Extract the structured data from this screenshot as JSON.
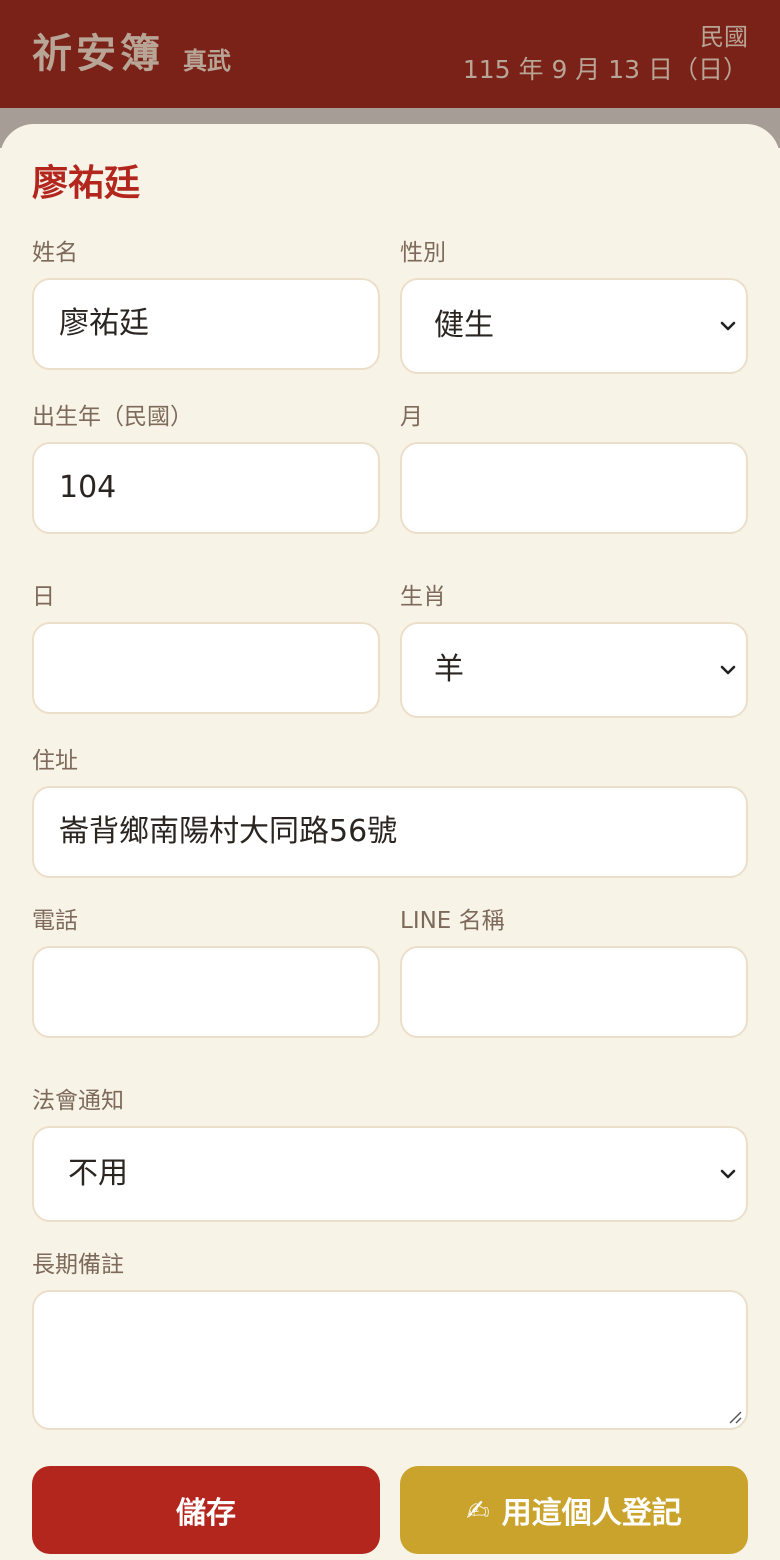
{
  "header": {
    "app_title": "祈安簿",
    "temple": "真武",
    "date_era": "民國",
    "date_full": "115 年 9 月 13 日（日）"
  },
  "form": {
    "title": "廖祐廷",
    "name": {
      "label": "姓名",
      "value": "廖祐廷"
    },
    "gender": {
      "label": "性別",
      "value": "健生"
    },
    "birth_year": {
      "label": "出生年（民國）",
      "value": "104"
    },
    "birth_month": {
      "label": "月",
      "value": ""
    },
    "birth_day": {
      "label": "日",
      "value": ""
    },
    "zodiac": {
      "label": "生肖",
      "value": "羊"
    },
    "address": {
      "label": "住址",
      "value": "崙背鄉南陽村大同路56號"
    },
    "phone": {
      "label": "電話",
      "value": ""
    },
    "line_name": {
      "label": "LINE 名稱",
      "value": ""
    },
    "notify": {
      "label": "法會通知",
      "value": "不用"
    },
    "notes": {
      "label": "長期備註",
      "value": ""
    }
  },
  "buttons": {
    "save": "儲存",
    "register_icon": "✍",
    "register": "用這個人登記"
  },
  "icons": {
    "chevron": "chevron-down-icon",
    "resize": "resize-grip-icon",
    "writing_hand": "writing-hand-icon"
  },
  "colors": {
    "header_bg": "#7a2118",
    "sheet_bg": "#f8f3e7",
    "accent_red": "#b3261e",
    "accent_gold": "#c9a32c",
    "field_border": "#ecdfca",
    "label_text": "#7d6a5a"
  }
}
